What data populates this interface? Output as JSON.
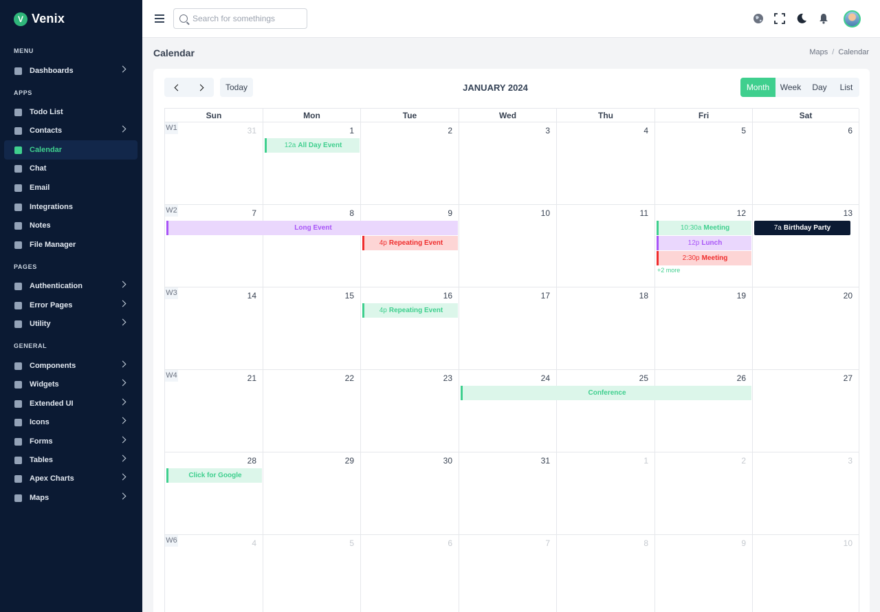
{
  "brand": {
    "logo": "V",
    "name": "Venix"
  },
  "sidebar": {
    "sections": [
      {
        "title": "MENU",
        "items": [
          {
            "label": "Dashboards",
            "icon": "dashboard-icon",
            "arrow": true
          }
        ]
      },
      {
        "title": "APPS",
        "items": [
          {
            "label": "Todo List",
            "icon": "todo-icon",
            "arrow": false
          },
          {
            "label": "Contacts",
            "icon": "contacts-icon",
            "arrow": true
          },
          {
            "label": "Calendar",
            "icon": "calendar-icon",
            "arrow": false,
            "active": true
          },
          {
            "label": "Chat",
            "icon": "chat-icon",
            "arrow": false
          },
          {
            "label": "Email",
            "icon": "email-icon",
            "arrow": false
          },
          {
            "label": "Integrations",
            "icon": "integrations-icon",
            "arrow": false
          },
          {
            "label": "Notes",
            "icon": "notes-icon",
            "arrow": false
          },
          {
            "label": "File Manager",
            "icon": "file-manager-icon",
            "arrow": false
          }
        ]
      },
      {
        "title": "PAGES",
        "items": [
          {
            "label": "Authentication",
            "icon": "authentication-icon",
            "arrow": true
          },
          {
            "label": "Error Pages",
            "icon": "error-pages-icon",
            "arrow": true
          },
          {
            "label": "Utility",
            "icon": "utility-icon",
            "arrow": true
          }
        ]
      },
      {
        "title": "GENERAL",
        "items": [
          {
            "label": "Components",
            "icon": "components-icon",
            "arrow": true
          },
          {
            "label": "Widgets",
            "icon": "widgets-icon",
            "arrow": true
          },
          {
            "label": "Extended UI",
            "icon": "extended-ui-icon",
            "arrow": true
          },
          {
            "label": "Icons",
            "icon": "icons-icon",
            "arrow": true
          },
          {
            "label": "Forms",
            "icon": "forms-icon",
            "arrow": true
          },
          {
            "label": "Tables",
            "icon": "tables-icon",
            "arrow": true
          },
          {
            "label": "Apex Charts",
            "icon": "apex-charts-icon",
            "arrow": true
          },
          {
            "label": "Maps",
            "icon": "maps-icon",
            "arrow": true
          }
        ]
      }
    ]
  },
  "topbar": {
    "search_placeholder": "Search for somethings",
    "icons": [
      "globe-icon",
      "fullscreen-icon",
      "dark-mode-icon",
      "notification-bell-icon"
    ]
  },
  "page": {
    "title": "Calendar",
    "breadcrumb": [
      "Maps",
      "Calendar"
    ]
  },
  "calendar": {
    "title": "JANUARY 2024",
    "today_label": "Today",
    "views": [
      {
        "label": "Month",
        "active": true
      },
      {
        "label": "Week"
      },
      {
        "label": "Day"
      },
      {
        "label": "List"
      }
    ],
    "weekdays": [
      "Sun",
      "Mon",
      "Tue",
      "Wed",
      "Thu",
      "Fri",
      "Sat"
    ],
    "weeks": [
      {
        "label": "W1",
        "days": [
          {
            "n": "31",
            "dim": true
          },
          {
            "n": "1"
          },
          {
            "n": "2"
          },
          {
            "n": "3"
          },
          {
            "n": "4"
          },
          {
            "n": "5"
          },
          {
            "n": "6"
          }
        ]
      },
      {
        "label": "W2",
        "days": [
          {
            "n": "7"
          },
          {
            "n": "8"
          },
          {
            "n": "9"
          },
          {
            "n": "10"
          },
          {
            "n": "11"
          },
          {
            "n": "12"
          },
          {
            "n": "13"
          }
        ]
      },
      {
        "label": "W3",
        "days": [
          {
            "n": "14"
          },
          {
            "n": "15"
          },
          {
            "n": "16"
          },
          {
            "n": "17"
          },
          {
            "n": "18"
          },
          {
            "n": "19"
          },
          {
            "n": "20"
          }
        ]
      },
      {
        "label": "W4",
        "days": [
          {
            "n": "21"
          },
          {
            "n": "22"
          },
          {
            "n": "23"
          },
          {
            "n": "24"
          },
          {
            "n": "25"
          },
          {
            "n": "26"
          },
          {
            "n": "27"
          }
        ]
      },
      {
        "label": "",
        "days": [
          {
            "n": "28"
          },
          {
            "n": "29"
          },
          {
            "n": "30"
          },
          {
            "n": "31"
          },
          {
            "n": "1",
            "dim": true
          },
          {
            "n": "2",
            "dim": true
          },
          {
            "n": "3",
            "dim": true
          }
        ]
      },
      {
        "label": "W6",
        "days": [
          {
            "n": "4",
            "dim": true
          },
          {
            "n": "5",
            "dim": true
          },
          {
            "n": "6",
            "dim": true
          },
          {
            "n": "7",
            "dim": true
          },
          {
            "n": "8",
            "dim": true
          },
          {
            "n": "9",
            "dim": true
          },
          {
            "n": "10",
            "dim": true
          }
        ]
      }
    ],
    "events": [
      {
        "week": 0,
        "start": 1,
        "span": 1,
        "slot": 0,
        "time": "12a",
        "title": "All Day Event",
        "color": "green"
      },
      {
        "week": 1,
        "start": 0,
        "span": 3,
        "slot": 0,
        "time": "",
        "title": "Long Event",
        "color": "purple"
      },
      {
        "week": 1,
        "start": 2,
        "span": 1,
        "slot": 1,
        "time": "4p",
        "title": "Repeating Event",
        "color": "red"
      },
      {
        "week": 1,
        "start": 5,
        "span": 1,
        "slot": 0,
        "time": "10:30a",
        "title": "Meeting",
        "color": "green"
      },
      {
        "week": 1,
        "start": 5,
        "span": 1,
        "slot": 1,
        "time": "12p",
        "title": "Lunch",
        "color": "purple"
      },
      {
        "week": 1,
        "start": 5,
        "span": 1,
        "slot": 2,
        "time": "2:30p",
        "title": "Meeting",
        "color": "red"
      },
      {
        "week": 1,
        "start": 6,
        "span": 1,
        "slot": 0,
        "time": "7a",
        "title": "Birthday Party",
        "color": "dark"
      },
      {
        "week": 2,
        "start": 2,
        "span": 1,
        "slot": 0,
        "time": "4p",
        "title": "Repeating Event",
        "color": "green"
      },
      {
        "week": 3,
        "start": 3,
        "span": 3,
        "slot": 0,
        "time": "",
        "title": "Conference",
        "color": "green"
      },
      {
        "week": 4,
        "start": 0,
        "span": 1,
        "slot": 0,
        "time": "",
        "title": "Click for Google",
        "color": "green"
      }
    ],
    "more_links": [
      {
        "week": 1,
        "day": 5,
        "label": "+2 more"
      }
    ]
  }
}
